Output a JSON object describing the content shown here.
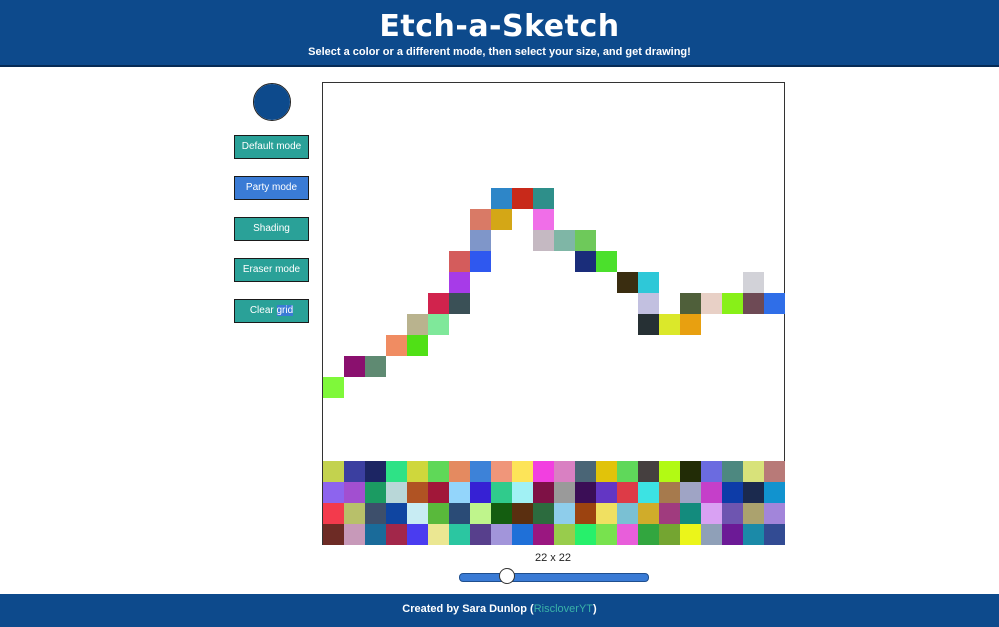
{
  "header": {
    "title": "Etch-a-Sketch",
    "subtitle": "Select a color or a different mode, then select your size, and get drawing!"
  },
  "color_picker": {
    "value": "#0d4a8c"
  },
  "buttons": {
    "default_mode": "Default mode",
    "party_mode": "Party mode",
    "shading": "Shading",
    "eraser_mode": "Eraser mode",
    "clear_grid_a": "Clear ",
    "clear_grid_b": "grid"
  },
  "colors": {
    "header_bg": "#0d4a8c",
    "button_teal": "#2aa198",
    "button_active_blue": "#3a7bd5",
    "footer_link": "#39b3a8"
  },
  "grid": {
    "size": 22,
    "size_label": "22 x 22",
    "slider_fraction": 0.25,
    "drawn_cells": [
      [
        8,
        5,
        "#2e86c8"
      ],
      [
        9,
        5,
        "#c8291a"
      ],
      [
        10,
        5,
        "#2e8f8a"
      ],
      [
        7,
        6,
        "#d97a66"
      ],
      [
        8,
        6,
        "#d4a716"
      ],
      [
        10,
        6,
        "#f06ee8"
      ],
      [
        7,
        7,
        "#7f96c9"
      ],
      [
        10,
        7,
        "#c5b9c2"
      ],
      [
        11,
        7,
        "#7fb6a6"
      ],
      [
        12,
        7,
        "#6ec95a"
      ],
      [
        6,
        8,
        "#d45c5c"
      ],
      [
        7,
        8,
        "#2f58ef"
      ],
      [
        12,
        8,
        "#1a2d7a"
      ],
      [
        13,
        8,
        "#4be02c"
      ],
      [
        6,
        9,
        "#a73be8"
      ],
      [
        14,
        9,
        "#3a2d10"
      ],
      [
        15,
        9,
        "#2ec8d8"
      ],
      [
        20,
        9,
        "#d2d2d8"
      ],
      [
        5,
        10,
        "#d1234d"
      ],
      [
        6,
        10,
        "#3a5056"
      ],
      [
        15,
        10,
        "#c2c0e0"
      ],
      [
        17,
        10,
        "#4f5f3a"
      ],
      [
        18,
        10,
        "#e8d0c6"
      ],
      [
        19,
        10,
        "#88f018"
      ],
      [
        20,
        10,
        "#6e4a55"
      ],
      [
        21,
        10,
        "#2f6ee8"
      ],
      [
        4,
        11,
        "#b9b38e"
      ],
      [
        5,
        11,
        "#7fe89a"
      ],
      [
        15,
        11,
        "#263034"
      ],
      [
        16,
        11,
        "#dbe82a"
      ],
      [
        17,
        11,
        "#e8a010"
      ],
      [
        3,
        12,
        "#f08c62"
      ],
      [
        4,
        12,
        "#50e016"
      ],
      [
        1,
        13,
        "#8a106e"
      ],
      [
        2,
        13,
        "#5f8a72"
      ],
      [
        0,
        14,
        "#7ff83a"
      ]
    ],
    "party_rows": [
      [
        "#c3d24e",
        "#3b3fa0",
        "#1c2563",
        "#2ee286",
        "#cfd73c",
        "#5fd858",
        "#e48a60",
        "#3d82d8",
        "#f0967a",
        "#fde458",
        "#f23fe0",
        "#d980c2",
        "#4a6576",
        "#e1c30a",
        "#5fd85a",
        "#453f3f",
        "#b2fa14",
        "#222c06",
        "#6b6be0",
        "#4d8880",
        "#d8e27a",
        "#b87a78"
      ],
      [
        "#8d64ee",
        "#a24fd0",
        "#1b9b62",
        "#b9d7d8",
        "#b05323",
        "#a11739",
        "#93d5fb",
        "#3621d4",
        "#30cb8c",
        "#a1f1f4",
        "#7e1145",
        "#9a9a9a",
        "#3b0e56",
        "#6336c4",
        "#dd3b47",
        "#3ce3e3",
        "#a67a4d",
        "#9fa4c5",
        "#c53fc9",
        "#0d3ca8",
        "#1b2a4e",
        "#1193cf"
      ],
      [
        "#f33a4c",
        "#b8c06a",
        "#3d4f6b",
        "#0f45a1",
        "#c8ecf3",
        "#59b93b",
        "#2a4b76",
        "#bff58c",
        "#145d10",
        "#5a2f10",
        "#2c6b3e",
        "#8ecdeb",
        "#9c4310",
        "#f0e061",
        "#7ac0d3",
        "#d0ac2a",
        "#a03b7e",
        "#138b7d",
        "#d9a1f3",
        "#6e55b0",
        "#aba26e",
        "#a285da"
      ],
      [
        "#6d2b25",
        "#c799b9",
        "#1a6b9a",
        "#a2274a",
        "#4a3cf0",
        "#ebe792",
        "#2bc6a1",
        "#573f8c",
        "#a295da",
        "#1f70d8",
        "#9a1780",
        "#98cc4c",
        "#27f06b",
        "#78e24e",
        "#e85eda",
        "#32a63f",
        "#74a531",
        "#ebf51a",
        "#8fa0b8",
        "#6c1a96",
        "#1b8aa8",
        "#324b93"
      ]
    ]
  },
  "footer": {
    "created_by": "Created by Sara Dunlop (",
    "author_link": "RiscloverYT",
    "close_paren": ")"
  }
}
